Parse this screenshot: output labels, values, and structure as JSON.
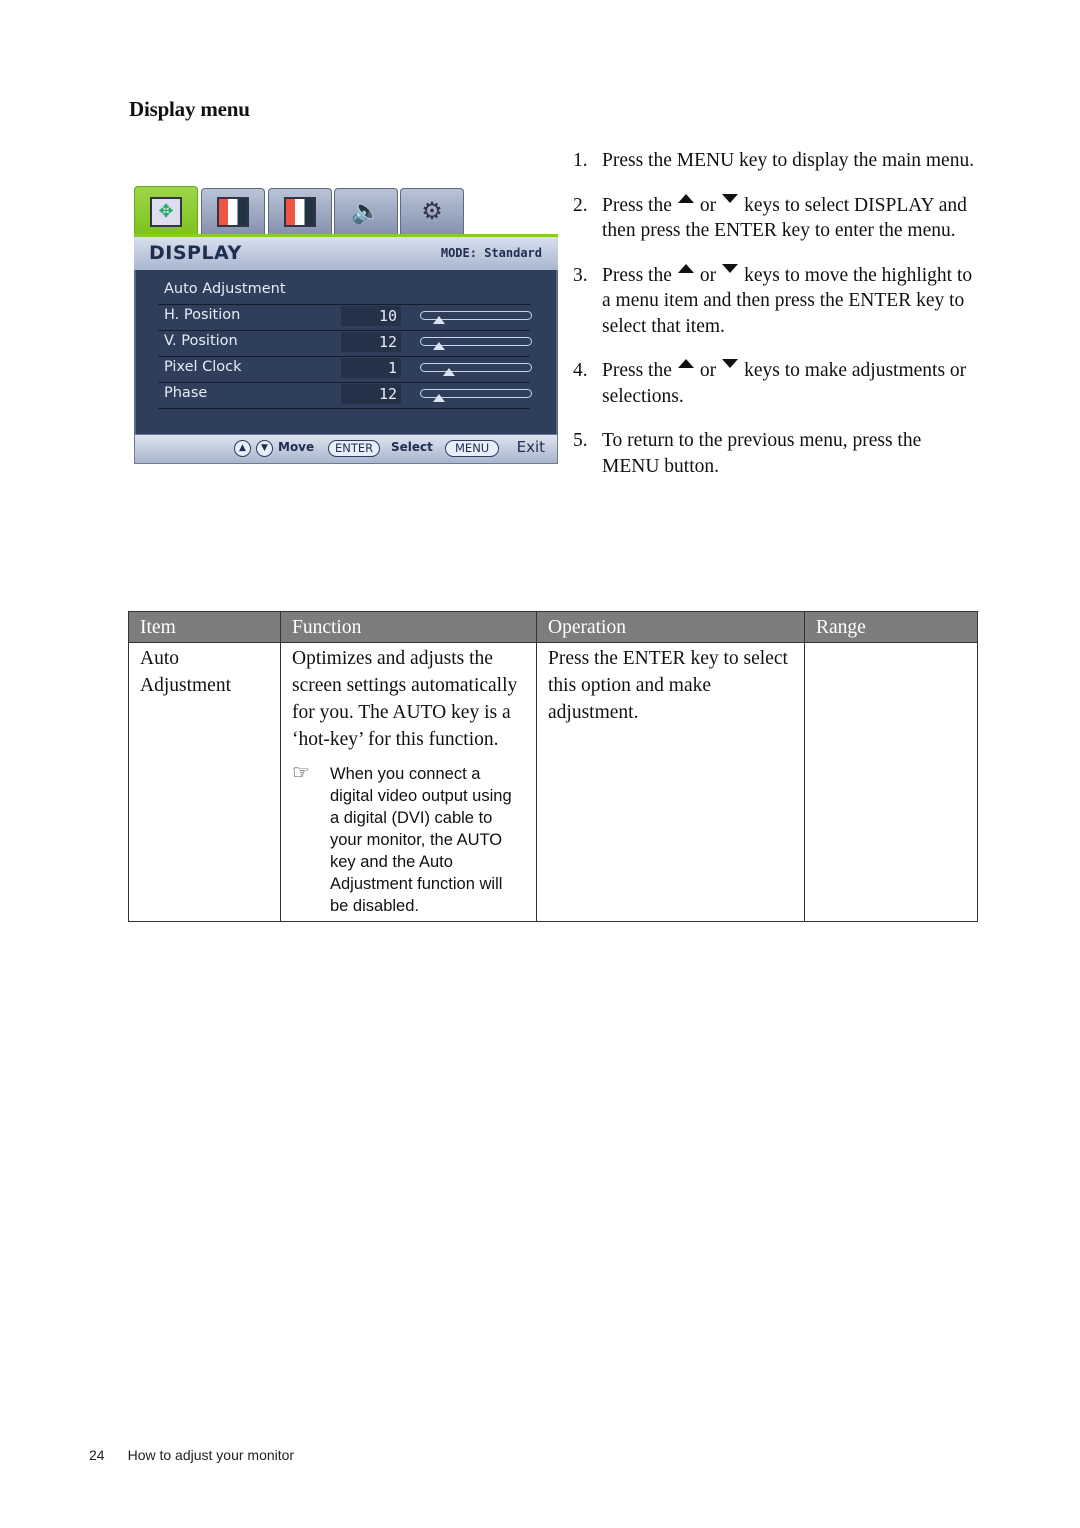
{
  "section_title": "Display menu",
  "osd": {
    "tabs": [
      {
        "name": "display",
        "icon": "display-icon",
        "active": true
      },
      {
        "name": "picture",
        "icon": "picture-icon",
        "active": false
      },
      {
        "name": "picture-advanced",
        "icon": "picture-advanced-icon",
        "active": false
      },
      {
        "name": "audio",
        "icon": "speaker-icon",
        "active": false
      },
      {
        "name": "system",
        "icon": "gear-icon",
        "active": false
      }
    ],
    "title": "DISPLAY",
    "mode": "MODE: Standard",
    "rows": [
      {
        "label": "Auto Adjustment"
      },
      {
        "label": "H. Position",
        "value": "10",
        "level": 0.12
      },
      {
        "label": "V. Position",
        "value": "12",
        "level": 0.12
      },
      {
        "label": "Pixel Clock",
        "value": "1",
        "level": 0.22
      },
      {
        "label": "Phase",
        "value": "12",
        "level": 0.12
      }
    ],
    "footer": {
      "up": "▲",
      "down": "▼",
      "move": "Move",
      "enter": "ENTER",
      "select": "Select",
      "menu": "MENU",
      "exit": "Exit"
    }
  },
  "steps": [
    {
      "num": "1.",
      "parts": [
        "Press the ",
        "MENU",
        " key to display the main menu."
      ]
    },
    {
      "num": "2.",
      "pre": "Press the",
      "or": "or",
      "post": "keys to select DISPLAY and then press the ENTER key to enter the menu."
    },
    {
      "num": "3.",
      "pre": "Press the",
      "or": "or",
      "post": "keys to move the highlight to a menu item and then press the ENTER key to select that item."
    },
    {
      "num": "4.",
      "pre": "Press the",
      "or": "or",
      "post": "keys to make adjustments or selections."
    },
    {
      "num": "5.",
      "text": "To return to the previous menu, press the MENU button."
    }
  ],
  "table": {
    "headers": [
      "Item",
      "Function",
      "Operation",
      "Range"
    ],
    "rows": [
      {
        "item": "Auto Adjustment",
        "function": "Optimizes and adjusts the screen settings automatically for you. The AUTO key is a ‘hot-key’ for this function.",
        "note": "When you connect a digital video output using a digital (DVI) cable to your monitor, the AUTO key and the Auto Adjustment function will be disabled.",
        "operation": "Press the ENTER key to select this option and make adjustment.",
        "range": ""
      }
    ]
  },
  "footer": {
    "page": "24",
    "title": "How to adjust your monitor"
  }
}
